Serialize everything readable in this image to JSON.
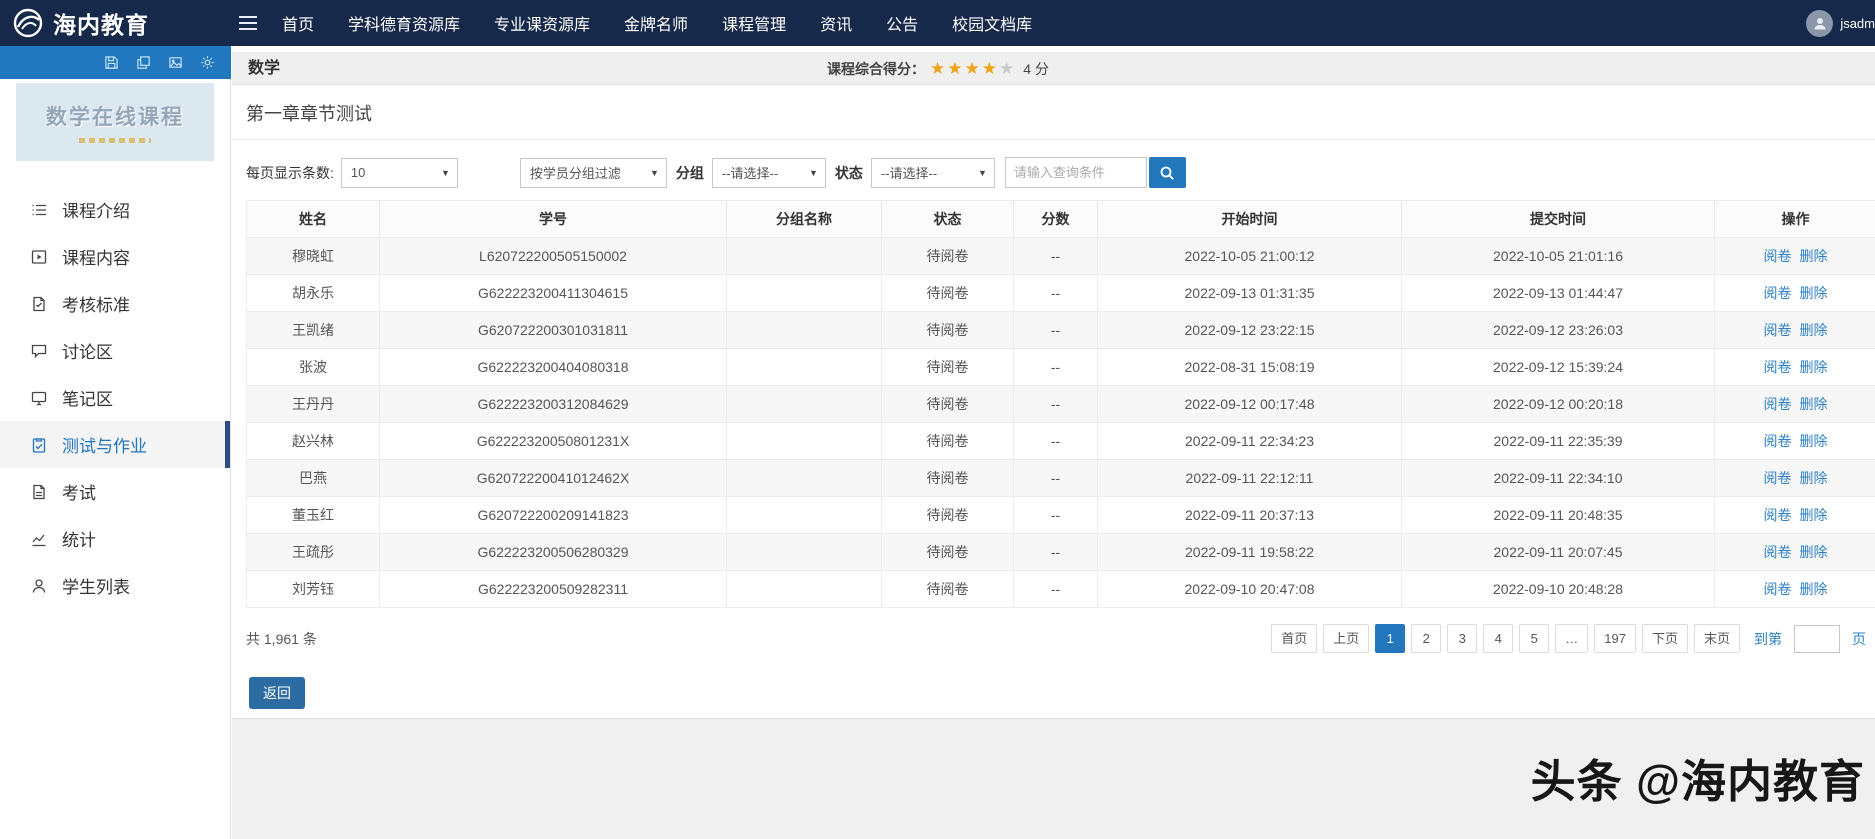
{
  "navbar": {
    "logo_text": "海内教育",
    "items": [
      "首页",
      "学科德育资源库",
      "专业课资源库",
      "金牌名师",
      "课程管理",
      "资讯",
      "公告",
      "校园文档库"
    ],
    "username": "jsadm"
  },
  "toolbar_icons": [
    "save-icon",
    "windows-icon",
    "image-icon",
    "gear-icon"
  ],
  "sidebar": {
    "thumbnail_text": "数学在线课程",
    "items": [
      {
        "label": "课程介绍",
        "icon": "list-icon",
        "active": false
      },
      {
        "label": "课程内容",
        "icon": "play-icon",
        "active": false
      },
      {
        "label": "考核标准",
        "icon": "file-check-icon",
        "active": false
      },
      {
        "label": "讨论区",
        "icon": "chat-icon",
        "active": false
      },
      {
        "label": "笔记区",
        "icon": "monitor-icon",
        "active": false
      },
      {
        "label": "测试与作业",
        "icon": "clipboard-check-icon",
        "active": true
      },
      {
        "label": "考试",
        "icon": "file-icon",
        "active": false
      },
      {
        "label": "统计",
        "icon": "chart-icon",
        "active": false
      },
      {
        "label": "学生列表",
        "icon": "person-icon",
        "active": false
      }
    ]
  },
  "header_bar": {
    "course_name": "数学",
    "score_label": "课程综合得分：",
    "stars_filled": 4,
    "stars_total": 5,
    "score_value": "4 分"
  },
  "content": {
    "section_title": "第一章章节测试",
    "filters": {
      "page_size_label": "每页显示条数:",
      "page_size_value": "10",
      "group_filter_value": "按学员分组过滤",
      "group_label": "分组",
      "group_placeholder": "--请选择--",
      "status_label": "状态",
      "status_placeholder": "--请选择--",
      "search_placeholder": "请输入查询条件"
    },
    "table": {
      "columns": [
        "姓名",
        "学号",
        "分组名称",
        "状态",
        "分数",
        "开始时间",
        "提交时间",
        "操作"
      ],
      "action_review": "阅卷",
      "action_delete": "删除",
      "rows": [
        {
          "name": "穆晓虹",
          "sid": "L620722200505150002",
          "group": "",
          "status": "待阅卷",
          "score": "--",
          "start": "2022-10-05 21:00:12",
          "submit": "2022-10-05 21:01:16"
        },
        {
          "name": "胡永乐",
          "sid": "G622223200411304615",
          "group": "",
          "status": "待阅卷",
          "score": "--",
          "start": "2022-09-13 01:31:35",
          "submit": "2022-09-13 01:44:47"
        },
        {
          "name": "王凯绪",
          "sid": "G620722200301031811",
          "group": "",
          "status": "待阅卷",
          "score": "--",
          "start": "2022-09-12 23:22:15",
          "submit": "2022-09-12 23:26:03"
        },
        {
          "name": "张波",
          "sid": "G622223200404080318",
          "group": "",
          "status": "待阅卷",
          "score": "--",
          "start": "2022-08-31 15:08:19",
          "submit": "2022-09-12 15:39:24"
        },
        {
          "name": "王丹丹",
          "sid": "G622223200312084629",
          "group": "",
          "status": "待阅卷",
          "score": "--",
          "start": "2022-09-12 00:17:48",
          "submit": "2022-09-12 00:20:18"
        },
        {
          "name": "赵兴林",
          "sid": "G62222320050801231X",
          "group": "",
          "status": "待阅卷",
          "score": "--",
          "start": "2022-09-11 22:34:23",
          "submit": "2022-09-11 22:35:39"
        },
        {
          "name": "巴燕",
          "sid": "G62072220041012462X",
          "group": "",
          "status": "待阅卷",
          "score": "--",
          "start": "2022-09-11 22:12:11",
          "submit": "2022-09-11 22:34:10"
        },
        {
          "name": "董玉红",
          "sid": "G620722200209141823",
          "group": "",
          "status": "待阅卷",
          "score": "--",
          "start": "2022-09-11 20:37:13",
          "submit": "2022-09-11 20:48:35"
        },
        {
          "name": "王疏彤",
          "sid": "G622223200506280329",
          "group": "",
          "status": "待阅卷",
          "score": "--",
          "start": "2022-09-11 19:58:22",
          "submit": "2022-09-11 20:07:45"
        },
        {
          "name": "刘芳钰",
          "sid": "G622223200509282311",
          "group": "",
          "status": "待阅卷",
          "score": "--",
          "start": "2022-09-10 20:47:08",
          "submit": "2022-09-10 20:48:28"
        }
      ]
    },
    "pagination": {
      "total_text": "共 1,961 条",
      "pages": [
        {
          "label": "首页",
          "active": false
        },
        {
          "label": "上页",
          "active": false
        },
        {
          "label": "1",
          "active": true
        },
        {
          "label": "2",
          "active": false
        },
        {
          "label": "3",
          "active": false
        },
        {
          "label": "4",
          "active": false
        },
        {
          "label": "5",
          "active": false
        },
        {
          "label": "…",
          "active": false
        },
        {
          "label": "197",
          "active": false
        },
        {
          "label": "下页",
          "active": false
        },
        {
          "label": "末页",
          "active": false
        }
      ],
      "goto_label": "到第",
      "goto_unit": "页"
    },
    "back_button": "返回"
  },
  "watermark": "头条 @海内教育",
  "colors": {
    "navbar_bg": "#16294a",
    "toolbar_bg": "#2178be",
    "accent_blue": "#2377bd",
    "link_blue": "#2e81c4",
    "active_marker": "#2b4c85",
    "star_gold": "#efa215"
  }
}
